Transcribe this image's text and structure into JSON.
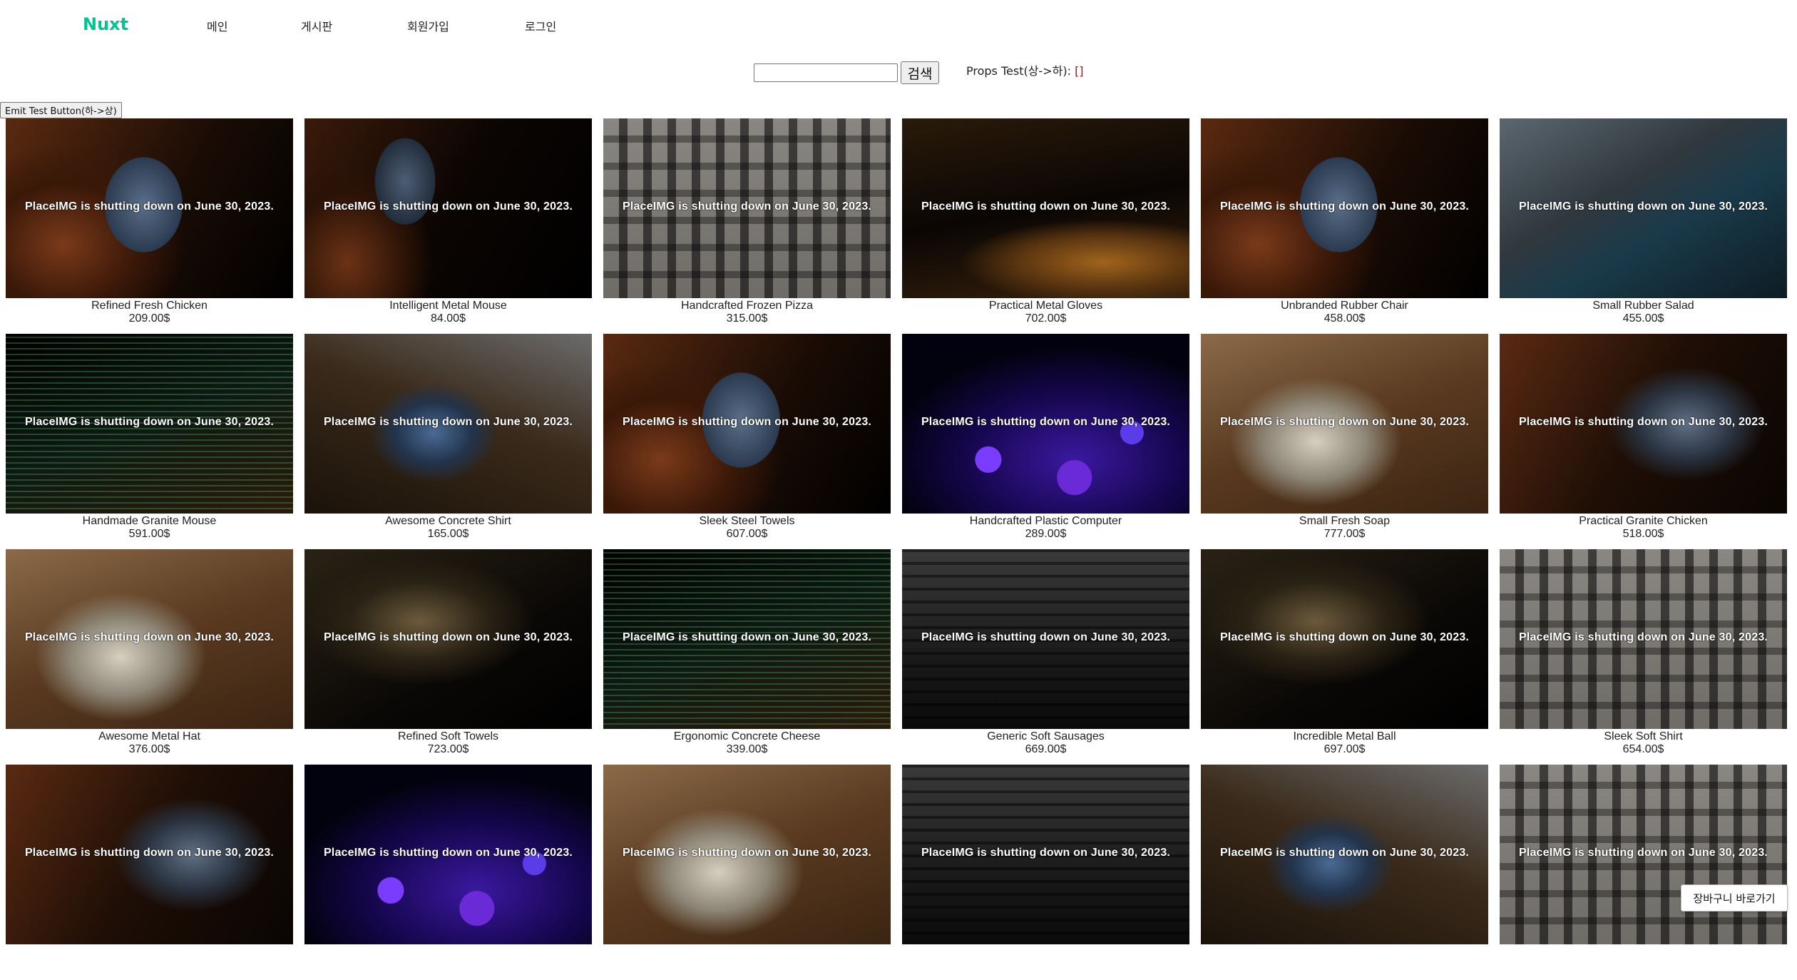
{
  "nav": {
    "brand": "Nuxt",
    "links": [
      "메인",
      "게시판",
      "회원가입",
      "로그인"
    ]
  },
  "search": {
    "value": "",
    "button": "검색"
  },
  "props_test": {
    "label": "Props Test(상->하):",
    "value": "[]"
  },
  "emit_button": "Emit Test Button(하->상)",
  "notice": "PlaceIMG is shutting down on June 30, 2023.",
  "products": [
    {
      "name": "Refined Fresh Chicken",
      "price": "209.00$",
      "image": "v-phone"
    },
    {
      "name": "Intelligent Metal Mouse",
      "price": "84.00$",
      "image": "v-phone2"
    },
    {
      "name": "Handcrafted Frozen Pizza",
      "price": "315.00$",
      "image": "v-parts"
    },
    {
      "name": "Practical Metal Gloves",
      "price": "702.00$",
      "image": "v-desk"
    },
    {
      "name": "Unbranded Rubber Chair",
      "price": "458.00$",
      "image": "v-phone"
    },
    {
      "name": "Small Rubber Salad",
      "price": "455.00$",
      "image": "v-laptop"
    },
    {
      "name": "Handmade Granite Mouse",
      "price": "591.00$",
      "image": "v-code"
    },
    {
      "name": "Awesome Concrete Shirt",
      "price": "165.00$",
      "image": "v-tablet"
    },
    {
      "name": "Sleek Steel Towels",
      "price": "607.00$",
      "image": "v-phone"
    },
    {
      "name": "Handcrafted Plastic Computer",
      "price": "289.00$",
      "image": "v-fiber"
    },
    {
      "name": "Small Fresh Soap",
      "price": "777.00$",
      "image": "v-book"
    },
    {
      "name": "Practical Granite Chicken",
      "price": "518.00$",
      "image": "v-tablet2"
    },
    {
      "name": "Awesome Metal Hat",
      "price": "376.00$",
      "image": "v-book"
    },
    {
      "name": "Refined Soft Towels",
      "price": "723.00$",
      "image": "v-welcome"
    },
    {
      "name": "Ergonomic Concrete Cheese",
      "price": "339.00$",
      "image": "v-code"
    },
    {
      "name": "Generic Soft Sausages",
      "price": "669.00$",
      "image": "v-keyboard"
    },
    {
      "name": "Incredible Metal Ball",
      "price": "697.00$",
      "image": "v-welcome"
    },
    {
      "name": "Sleek Soft Shirt",
      "price": "654.00$",
      "image": "v-parts"
    },
    {
      "name": "",
      "price": "",
      "image": "v-tablet2"
    },
    {
      "name": "",
      "price": "",
      "image": "v-fiber"
    },
    {
      "name": "",
      "price": "",
      "image": "v-book"
    },
    {
      "name": "",
      "price": "",
      "image": "v-keyboard"
    },
    {
      "name": "",
      "price": "",
      "image": "v-tablet"
    },
    {
      "name": "",
      "price": "",
      "image": "v-parts"
    }
  ],
  "cart_button": "장바구니 바로가기"
}
